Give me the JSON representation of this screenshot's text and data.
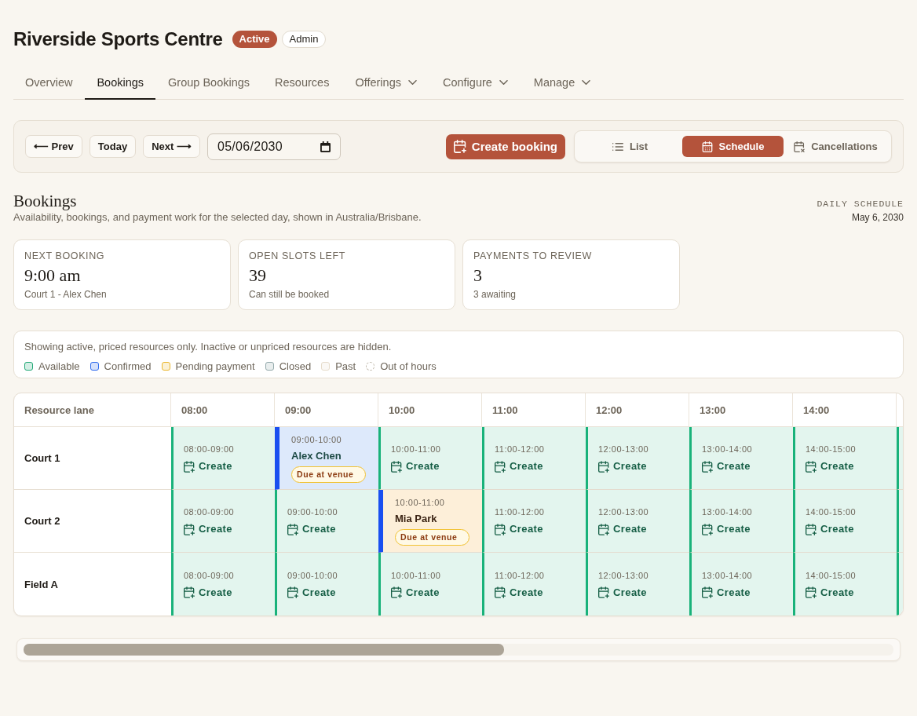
{
  "header": {
    "title": "Riverside Sports Centre",
    "badges": [
      {
        "label": "Active",
        "kind": "status"
      },
      {
        "label": "Admin",
        "kind": "role"
      }
    ]
  },
  "tabs": [
    {
      "label": "Overview",
      "selected": false,
      "dropdown": false
    },
    {
      "label": "Bookings",
      "selected": true,
      "dropdown": false
    },
    {
      "label": "Group Bookings",
      "selected": false,
      "dropdown": false
    },
    {
      "label": "Resources",
      "selected": false,
      "dropdown": false
    },
    {
      "label": "Offerings",
      "selected": false,
      "dropdown": true
    },
    {
      "label": "Configure",
      "selected": false,
      "dropdown": true
    },
    {
      "label": "Manage",
      "selected": false,
      "dropdown": true
    }
  ],
  "toolbar": {
    "nav_buttons": [
      "⟵ Prev",
      "Today",
      "Next ⟶"
    ],
    "date_field": {
      "value": "05/06/2030"
    },
    "create_button": "Create booking",
    "views": [
      {
        "label": "List",
        "selected": false
      },
      {
        "label": "Schedule",
        "selected": true
      },
      {
        "label": "Cancellations",
        "selected": false
      }
    ]
  },
  "section": {
    "title": "Bookings",
    "subtitle": "Availability, bookings, and payment work for the selected day, shown in Australia/Brisbane.",
    "eyebrow": "DAILY SCHEDULE",
    "date": "May 6, 2030"
  },
  "stats": [
    {
      "label": "NEXT BOOKING",
      "value": "9:00 am",
      "note": "Court 1 - Alex Chen"
    },
    {
      "label": "OPEN SLOTS LEFT",
      "value": "39",
      "note": "Can still be booked"
    },
    {
      "label": "PAYMENTS TO REVIEW",
      "value": "3",
      "note": "3 awaiting"
    }
  ],
  "legend": {
    "note": "Showing active, priced resources only. Inactive or unpriced resources are hidden.",
    "items": [
      {
        "label": "Available",
        "color": "#22a876",
        "kind": "solid"
      },
      {
        "label": "Confirmed",
        "color": "#2f6bed",
        "kind": "solid"
      },
      {
        "label": "Pending payment",
        "color": "#eab72f",
        "kind": "solid"
      },
      {
        "label": "Closed",
        "color": "#93a9ab",
        "kind": "solid"
      },
      {
        "label": "Past",
        "color": "#e6dccb",
        "kind": "solid"
      },
      {
        "label": "Out of hours",
        "color": "#c4bcaf",
        "kind": "dashed"
      }
    ]
  },
  "schedule": {
    "columns": [
      "Resource lane",
      "08:00",
      "09:00",
      "10:00",
      "11:00",
      "12:00",
      "13:00",
      "14:00"
    ],
    "rows": [
      {
        "cells": [
          {
            "kind": "lane",
            "label": "Court 1"
          },
          {
            "kind": "available",
            "time": "08:00-09:00",
            "action": "Create"
          },
          {
            "kind": "confirmed",
            "time": "09:00-10:00",
            "name": "Alex Chen",
            "badge": "Due at venue"
          },
          {
            "kind": "available",
            "time": "10:00-11:00",
            "action": "Create"
          },
          {
            "kind": "available",
            "time": "11:00-12:00",
            "action": "Create"
          },
          {
            "kind": "available",
            "time": "12:00-13:00",
            "action": "Create"
          },
          {
            "kind": "available",
            "time": "13:00-14:00",
            "action": "Create"
          },
          {
            "kind": "available",
            "time": "14:00-15:00",
            "action": "Create"
          },
          {
            "kind": "available"
          }
        ]
      },
      {
        "cells": [
          {
            "kind": "lane",
            "label": "Court 2"
          },
          {
            "kind": "available",
            "time": "08:00-09:00",
            "action": "Create"
          },
          {
            "kind": "available",
            "time": "09:00-10:00",
            "action": "Create"
          },
          {
            "kind": "pending",
            "time": "10:00-11:00",
            "name": "Mia Park",
            "badge": "Due at venue"
          },
          {
            "kind": "available",
            "time": "11:00-12:00",
            "action": "Create"
          },
          {
            "kind": "available",
            "time": "12:00-13:00",
            "action": "Create"
          },
          {
            "kind": "available",
            "time": "13:00-14:00",
            "action": "Create"
          },
          {
            "kind": "available",
            "time": "14:00-15:00",
            "action": "Create"
          },
          {
            "kind": "available"
          }
        ]
      },
      {
        "cells": [
          {
            "kind": "lane",
            "label": "Field A"
          },
          {
            "kind": "available",
            "time": "08:00-09:00",
            "action": "Create"
          },
          {
            "kind": "available",
            "time": "09:00-10:00",
            "action": "Create"
          },
          {
            "kind": "available",
            "time": "10:00-11:00",
            "action": "Create"
          },
          {
            "kind": "available",
            "time": "11:00-12:00",
            "action": "Create"
          },
          {
            "kind": "available",
            "time": "12:00-13:00",
            "action": "Create"
          },
          {
            "kind": "available",
            "time": "13:00-14:00",
            "action": "Create"
          },
          {
            "kind": "available",
            "time": "14:00-15:00",
            "action": "Create"
          },
          {
            "kind": "available"
          }
        ]
      }
    ]
  }
}
